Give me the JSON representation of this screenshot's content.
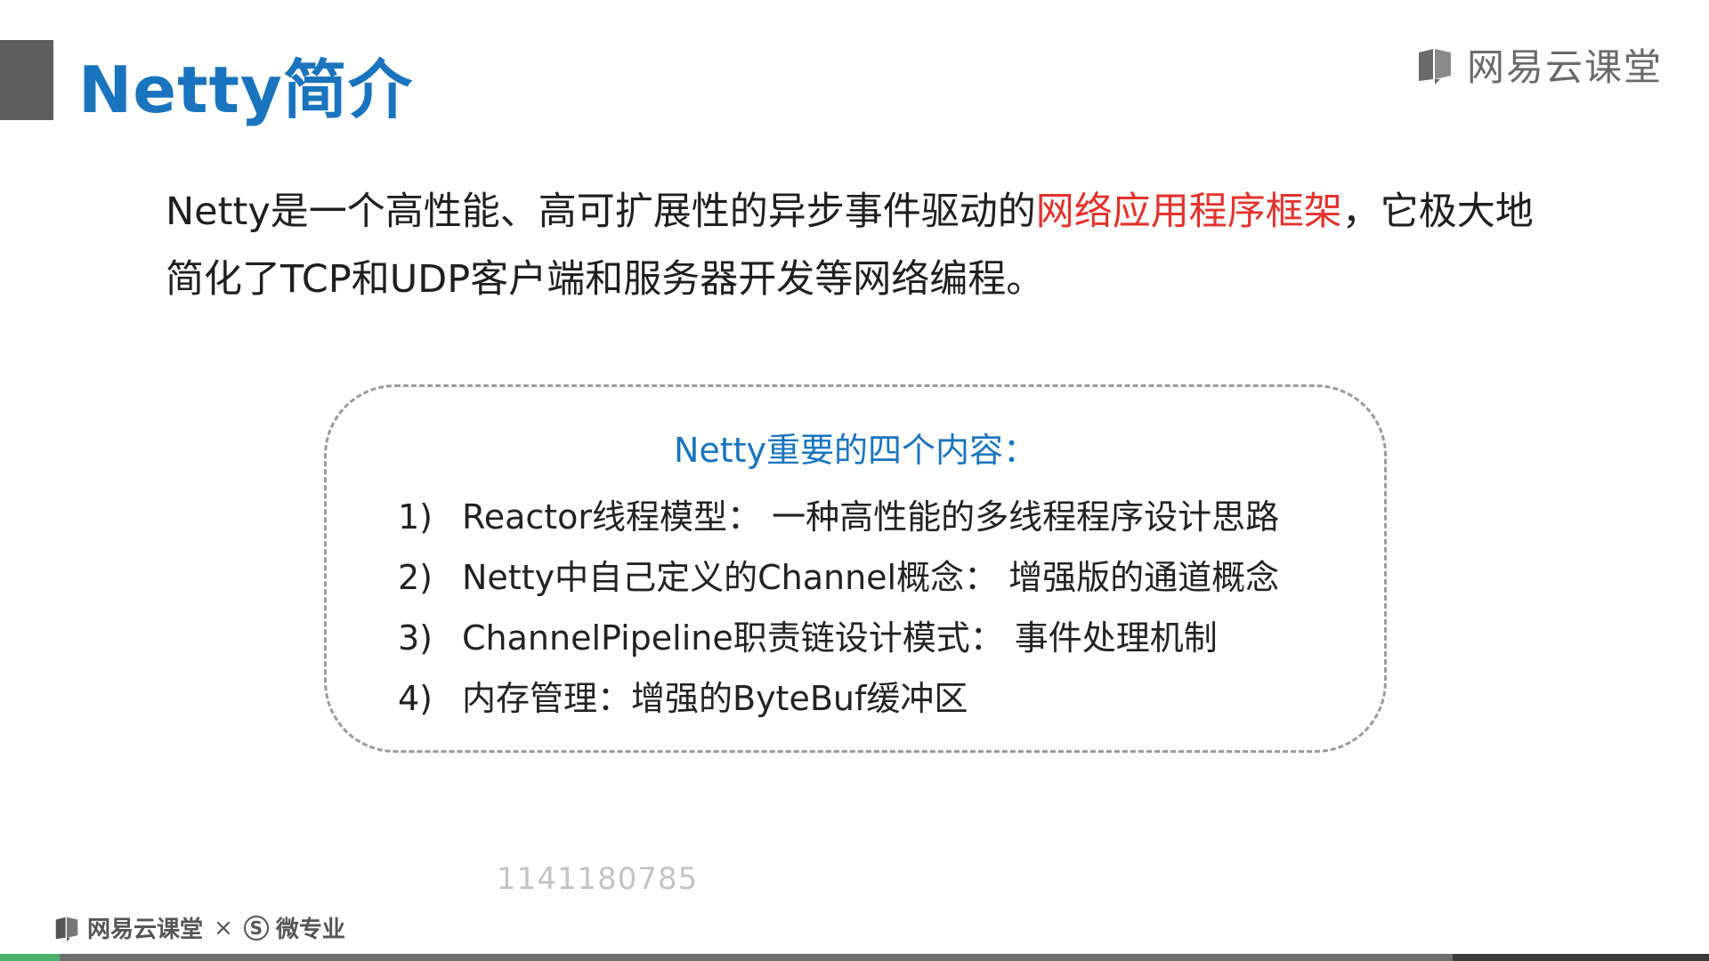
{
  "header": {
    "title": "Netty简介",
    "brand": "网易云课堂",
    "brand_icon": "book-icon"
  },
  "intro": {
    "part1": "Netty是一个高性能、高可扩展性的异步事件驱动的",
    "highlight": "网络应用程序框架",
    "part2": "，它极大地简化了TCP和UDP客户端和服务器开发等网络编程。",
    "highlight_color": "#e3322c"
  },
  "box": {
    "title": "Netty重要的四个内容：",
    "items": [
      {
        "num": "1)",
        "text": "Reactor线程模型：  一种高性能的多线程程序设计思路"
      },
      {
        "num": "2)",
        "text": "Netty中自己定义的Channel概念：  增强版的通道概念"
      },
      {
        "num": "3)",
        "text": "ChannelPipeline职责链设计模式：  事件处理机制"
      },
      {
        "num": "4)",
        "text": "内存管理：增强的ByteBuf缓冲区"
      }
    ]
  },
  "watermark": "1141180785",
  "footer": {
    "brand": "网易云课堂",
    "separator": "×",
    "partner_icon": "s-icon",
    "partner": "微专业"
  },
  "colors": {
    "title_blue": "#1a74bd",
    "accent_red": "#e3322c",
    "progress_green": "#4bb36b"
  },
  "progress": {
    "played_fraction": 0.035,
    "buffered_until_fraction": 0.85
  }
}
